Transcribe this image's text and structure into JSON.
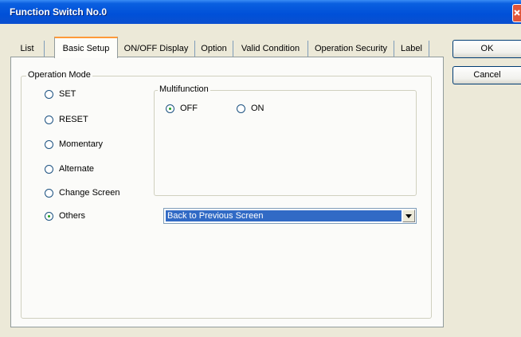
{
  "window": {
    "title": "Function Switch No.0"
  },
  "tabs": [
    {
      "label": "List"
    },
    {
      "label": "Basic Setup"
    },
    {
      "label": "ON/OFF Display"
    },
    {
      "label": "Option"
    },
    {
      "label": "Valid Condition"
    },
    {
      "label": "Operation Security"
    },
    {
      "label": "Label"
    }
  ],
  "active_tab": "Basic Setup",
  "operation_mode": {
    "legend": "Operation Mode",
    "options": [
      {
        "label": "SET",
        "selected": false
      },
      {
        "label": "RESET",
        "selected": false
      },
      {
        "label": "Momentary",
        "selected": false
      },
      {
        "label": "Alternate",
        "selected": false
      },
      {
        "label": "Change Screen",
        "selected": false
      },
      {
        "label": "Others",
        "selected": true
      }
    ]
  },
  "multifunction": {
    "legend": "Multifunction",
    "options": [
      {
        "label": "OFF",
        "selected": true
      },
      {
        "label": "ON",
        "selected": false
      }
    ]
  },
  "others_select": {
    "value": "Back to Previous Screen"
  },
  "buttons": {
    "ok_label": "OK",
    "cancel_label": "Cancel"
  },
  "colors": {
    "title_bar": "#0050d8",
    "selection": "#316ac5",
    "radio_dot": "#21a121",
    "active_tab_accent": "#ff9a3a"
  }
}
